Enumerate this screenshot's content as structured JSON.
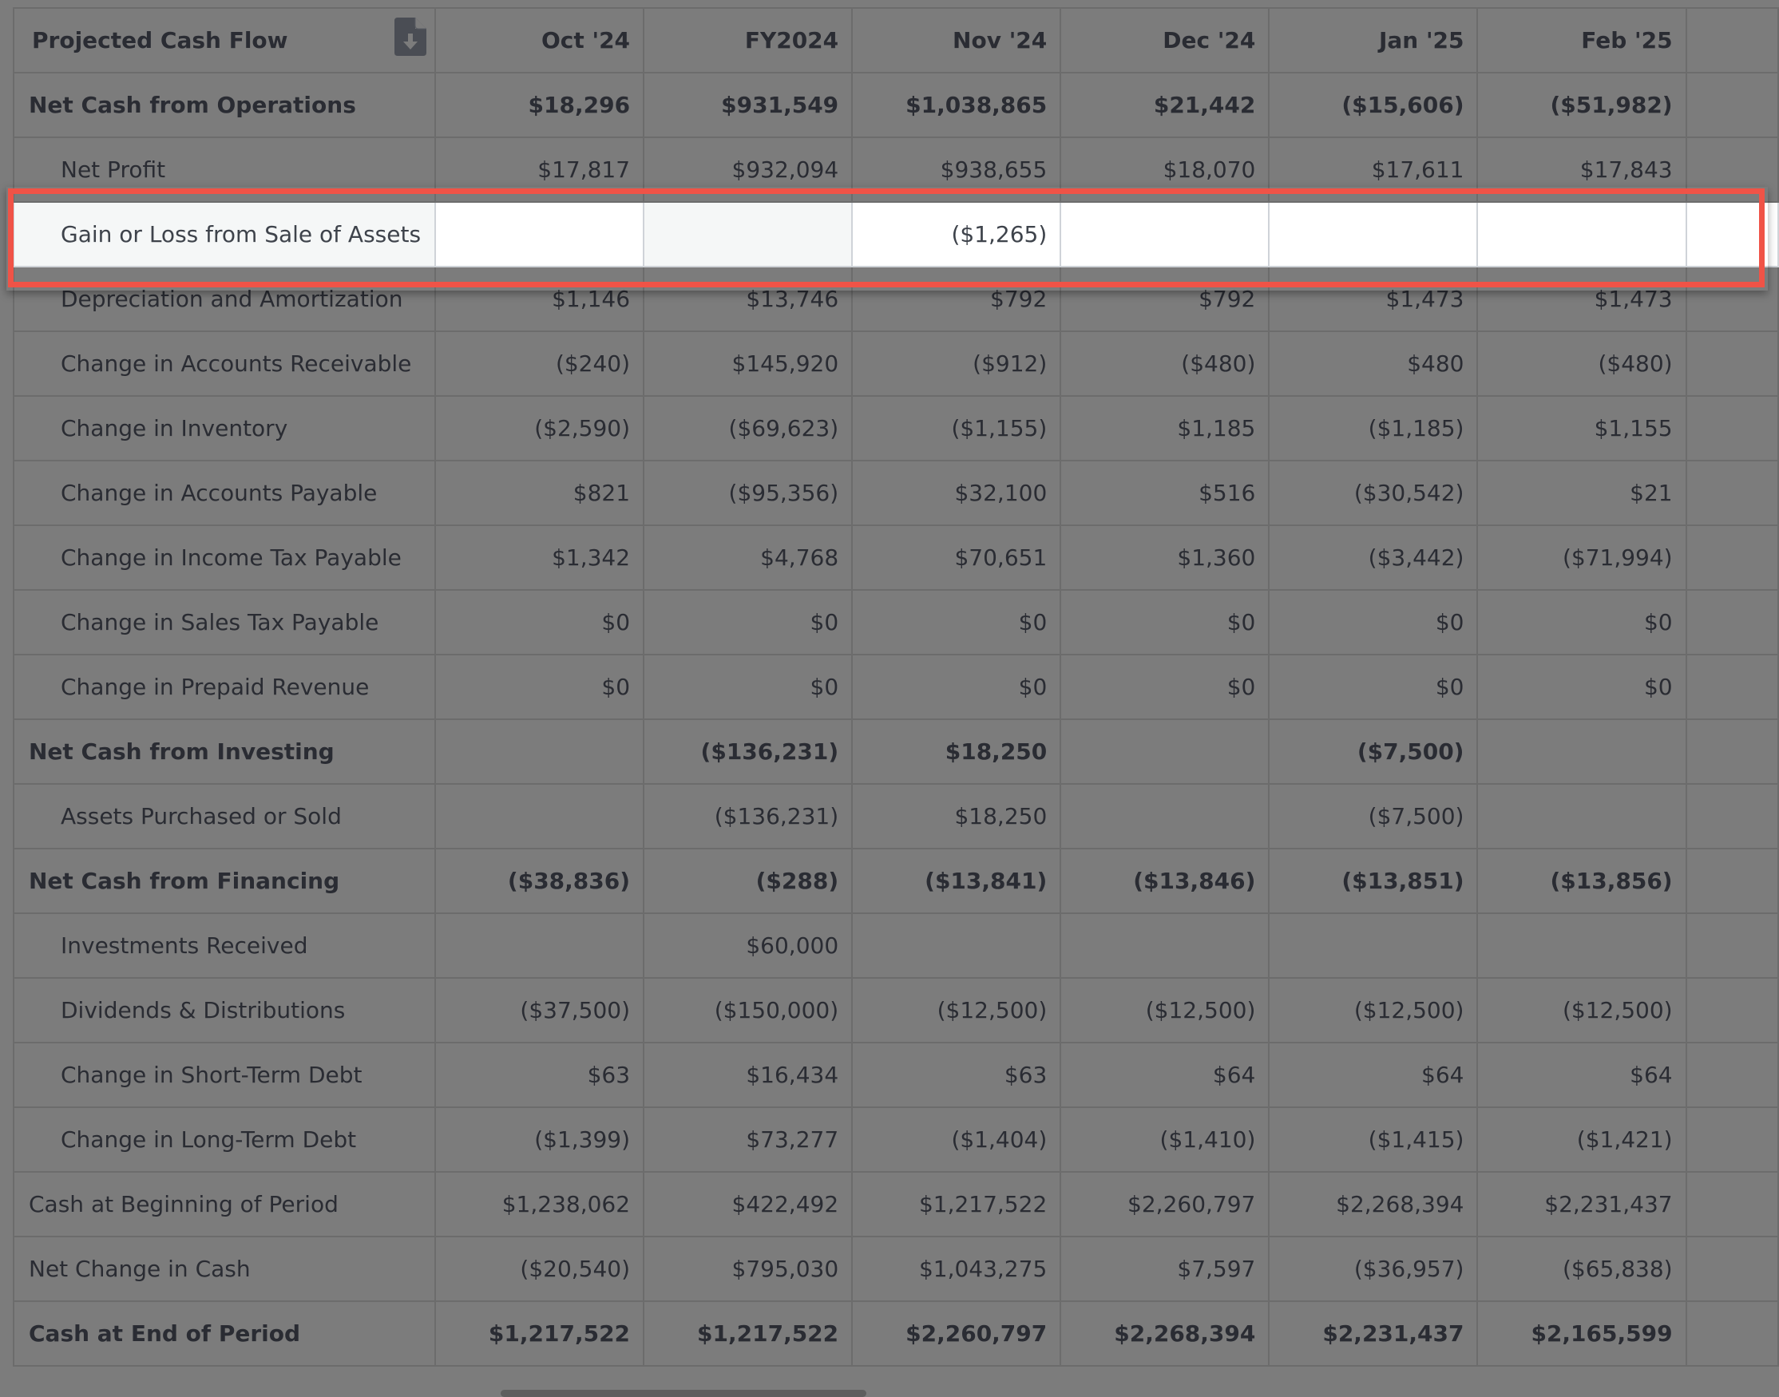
{
  "table": {
    "title": "Projected Cash Flow",
    "export_icon": "file-download-icon",
    "columns": [
      "Oct '24",
      "FY2024",
      "Nov '24",
      "Dec '24",
      "Jan '25",
      "Feb '25"
    ],
    "rows": [
      {
        "label": "Net Cash from Operations",
        "bold": true,
        "indent": false,
        "values": [
          "$18,296",
          "$931,549",
          "$1,038,865",
          "$21,442",
          "($15,606)",
          "($51,982)"
        ]
      },
      {
        "label": "Net Profit",
        "bold": false,
        "indent": true,
        "values": [
          "$17,817",
          "$932,094",
          "$938,655",
          "$18,070",
          "$17,611",
          "$17,843"
        ]
      },
      {
        "label": "Gain or Loss from Sale of Assets",
        "bold": false,
        "indent": true,
        "highlighted": true,
        "values": [
          "",
          "",
          "($1,265)",
          "",
          "",
          ""
        ]
      },
      {
        "label": "Depreciation and Amortization",
        "bold": false,
        "indent": true,
        "values": [
          "$1,146",
          "$13,746",
          "$792",
          "$792",
          "$1,473",
          "$1,473"
        ]
      },
      {
        "label": "Change in Accounts Receivable",
        "bold": false,
        "indent": true,
        "values": [
          "($240)",
          "$145,920",
          "($912)",
          "($480)",
          "$480",
          "($480)"
        ]
      },
      {
        "label": "Change in Inventory",
        "bold": false,
        "indent": true,
        "values": [
          "($2,590)",
          "($69,623)",
          "($1,155)",
          "$1,185",
          "($1,185)",
          "$1,155"
        ]
      },
      {
        "label": "Change in Accounts Payable",
        "bold": false,
        "indent": true,
        "values": [
          "$821",
          "($95,356)",
          "$32,100",
          "$516",
          "($30,542)",
          "$21"
        ]
      },
      {
        "label": "Change in Income Tax Payable",
        "bold": false,
        "indent": true,
        "values": [
          "$1,342",
          "$4,768",
          "$70,651",
          "$1,360",
          "($3,442)",
          "($71,994)"
        ]
      },
      {
        "label": "Change in Sales Tax Payable",
        "bold": false,
        "indent": true,
        "values": [
          "$0",
          "$0",
          "$0",
          "$0",
          "$0",
          "$0"
        ]
      },
      {
        "label": "Change in Prepaid Revenue",
        "bold": false,
        "indent": true,
        "values": [
          "$0",
          "$0",
          "$0",
          "$0",
          "$0",
          "$0"
        ]
      },
      {
        "label": "Net Cash from Investing",
        "bold": true,
        "indent": false,
        "values": [
          "",
          "($136,231)",
          "$18,250",
          "",
          "($7,500)",
          ""
        ]
      },
      {
        "label": "Assets Purchased or Sold",
        "bold": false,
        "indent": true,
        "values": [
          "",
          "($136,231)",
          "$18,250",
          "",
          "($7,500)",
          ""
        ]
      },
      {
        "label": "Net Cash from Financing",
        "bold": true,
        "indent": false,
        "values": [
          "($38,836)",
          "($288)",
          "($13,841)",
          "($13,846)",
          "($13,851)",
          "($13,856)"
        ]
      },
      {
        "label": "Investments Received",
        "bold": false,
        "indent": true,
        "values": [
          "",
          "$60,000",
          "",
          "",
          "",
          ""
        ]
      },
      {
        "label": "Dividends & Distributions",
        "bold": false,
        "indent": true,
        "values": [
          "($37,500)",
          "($150,000)",
          "($12,500)",
          "($12,500)",
          "($12,500)",
          "($12,500)"
        ]
      },
      {
        "label": "Change in Short-Term Debt",
        "bold": false,
        "indent": true,
        "values": [
          "$63",
          "$16,434",
          "$63",
          "$64",
          "$64",
          "$64"
        ]
      },
      {
        "label": "Change in Long-Term Debt",
        "bold": false,
        "indent": true,
        "values": [
          "($1,399)",
          "$73,277",
          "($1,404)",
          "($1,410)",
          "($1,415)",
          "($1,421)"
        ]
      },
      {
        "label": "Cash at Beginning of Period",
        "bold": false,
        "indent": false,
        "values": [
          "$1,238,062",
          "$422,492",
          "$1,217,522",
          "$2,260,797",
          "$2,268,394",
          "$2,231,437"
        ]
      },
      {
        "label": "Net Change in Cash",
        "bold": false,
        "indent": false,
        "values": [
          "($20,540)",
          "$795,030",
          "$1,043,275",
          "$7,597",
          "($36,957)",
          "($65,838)"
        ]
      },
      {
        "label": "Cash at End of Period",
        "bold": true,
        "indent": false,
        "values": [
          "$1,217,522",
          "$1,217,522",
          "$2,260,797",
          "$2,268,394",
          "$2,231,437",
          "$2,165,599"
        ]
      }
    ]
  },
  "colors": {
    "overlay": "#7c7c7c",
    "highlight_border": "#f05347",
    "highlight_bg": "#ffffff",
    "text": "#2a2c33"
  }
}
